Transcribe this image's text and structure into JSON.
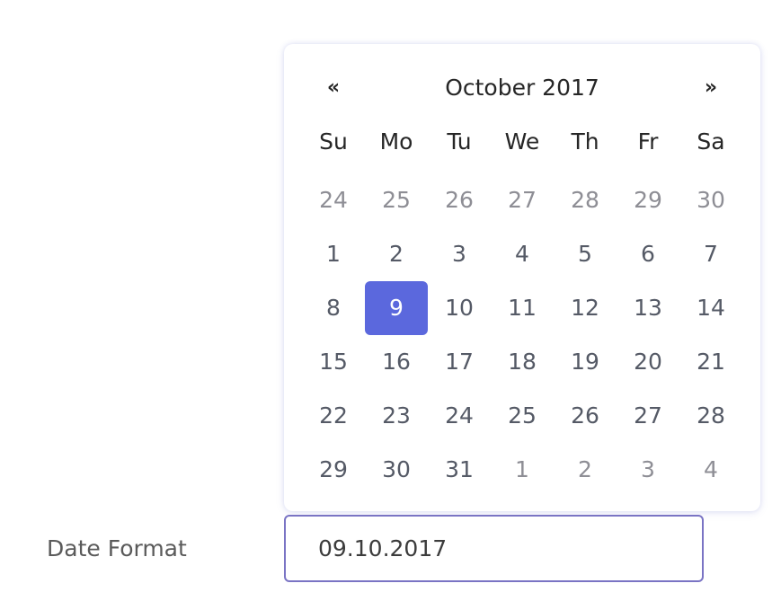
{
  "datepicker": {
    "prev_label": "«",
    "next_label": "»",
    "title": "October 2017",
    "weekdays": [
      "Su",
      "Mo",
      "Tu",
      "We",
      "Th",
      "Fr",
      "Sa"
    ],
    "weeks": [
      [
        {
          "label": "24",
          "muted": true
        },
        {
          "label": "25",
          "muted": true
        },
        {
          "label": "26",
          "muted": true
        },
        {
          "label": "27",
          "muted": true
        },
        {
          "label": "28",
          "muted": true
        },
        {
          "label": "29",
          "muted": true
        },
        {
          "label": "30",
          "muted": true
        }
      ],
      [
        {
          "label": "1"
        },
        {
          "label": "2"
        },
        {
          "label": "3"
        },
        {
          "label": "4"
        },
        {
          "label": "5"
        },
        {
          "label": "6"
        },
        {
          "label": "7"
        }
      ],
      [
        {
          "label": "8"
        },
        {
          "label": "9",
          "selected": true
        },
        {
          "label": "10"
        },
        {
          "label": "11"
        },
        {
          "label": "12"
        },
        {
          "label": "13"
        },
        {
          "label": "14"
        }
      ],
      [
        {
          "label": "15"
        },
        {
          "label": "16"
        },
        {
          "label": "17"
        },
        {
          "label": "18"
        },
        {
          "label": "19"
        },
        {
          "label": "20"
        },
        {
          "label": "21"
        }
      ],
      [
        {
          "label": "22"
        },
        {
          "label": "23"
        },
        {
          "label": "24"
        },
        {
          "label": "25"
        },
        {
          "label": "26"
        },
        {
          "label": "27"
        },
        {
          "label": "28"
        }
      ],
      [
        {
          "label": "29"
        },
        {
          "label": "30"
        },
        {
          "label": "31"
        },
        {
          "label": "1",
          "muted": true
        },
        {
          "label": "2",
          "muted": true
        },
        {
          "label": "3",
          "muted": true
        },
        {
          "label": "4",
          "muted": true
        }
      ]
    ],
    "selected_color": "#5b68dd"
  },
  "form": {
    "label": "Date Format",
    "value": "09.10.2017",
    "input_border_color": "#7a74c4"
  }
}
